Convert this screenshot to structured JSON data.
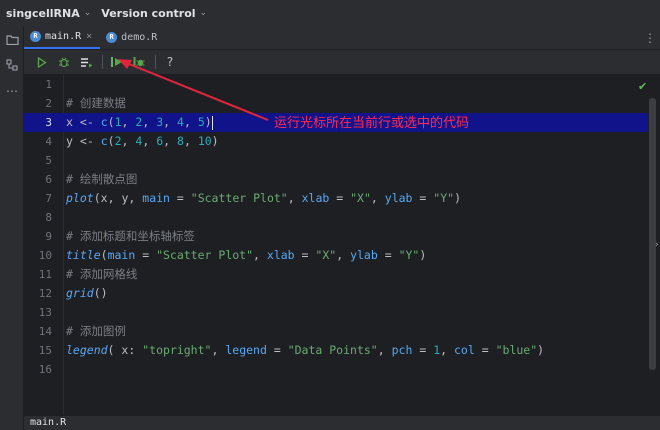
{
  "titlebar": {
    "project": "singcellRNA",
    "vcs": "Version control"
  },
  "tabs": [
    {
      "label": "main.R",
      "active": true
    },
    {
      "label": "demo.R",
      "active": false
    }
  ],
  "toolbar": {
    "help": "?"
  },
  "editor": {
    "current_line": 3,
    "line_numbers": [
      "1",
      "2",
      "3",
      "4",
      "5",
      "6",
      "7",
      "8",
      "9",
      "10",
      "11",
      "12",
      "13",
      "14",
      "15",
      "16"
    ],
    "lines": [
      "",
      "# 创建数据",
      "x <- c(1, 2, 3, 4, 5)",
      "y <- c(2, 4, 6, 8, 10)",
      "",
      "# 绘制散点图",
      "plot(x, y, main = \"Scatter Plot\", xlab = \"X\", ylab = \"Y\")",
      "",
      "# 添加标题和坐标轴标签",
      "title(main = \"Scatter Plot\", xlab = \"X\", ylab = \"Y\")",
      "# 添加网格线",
      "grid()",
      "",
      "# 添加图例",
      "legend( x: \"topright\", legend = \"Data Points\", pch = 1, col = \"blue\")",
      ""
    ],
    "inlay_hint": "x:"
  },
  "annotation": {
    "text": "运行光标所在当前行或选中的代码",
    "color": "#ff2a55"
  },
  "statusbar": {
    "file": "main.R"
  },
  "colors": {
    "background": "#1e1f22",
    "panel": "#2b2d30",
    "current_line_highlight": "#11138a",
    "accent": "#3574f0",
    "run_green": "#57a64a"
  }
}
